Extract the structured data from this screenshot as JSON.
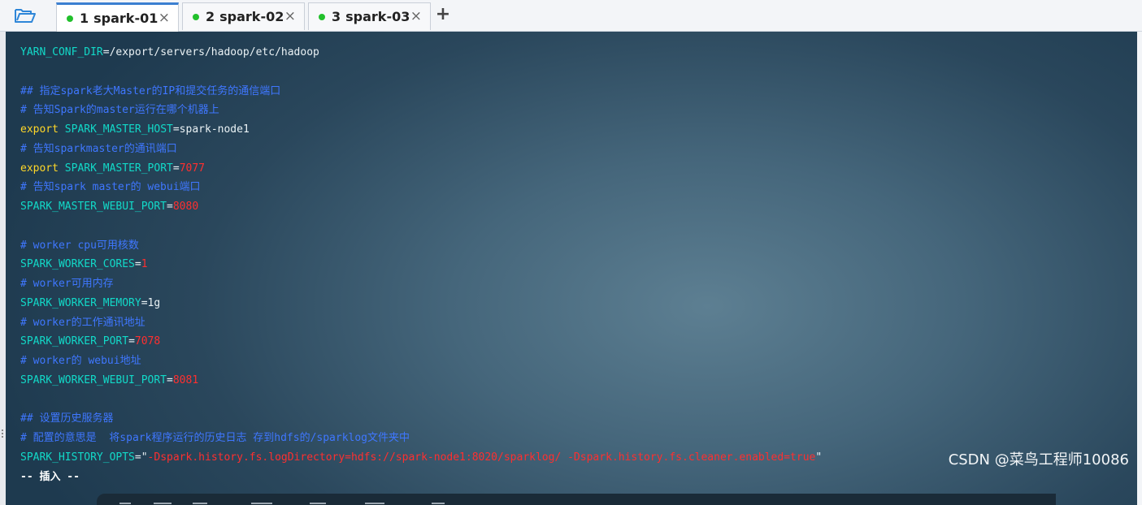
{
  "colors": {
    "accent": "#3b7fd1",
    "session_dot": "#22c02c",
    "variable": "#12d9c8",
    "value_number": "#ff2f2f",
    "keyword": "#ffd728",
    "comment": "#3f77ff"
  },
  "toolbar": {
    "folder_icon": "folder-open-icon"
  },
  "tabs": [
    {
      "number": "1",
      "label": "spark-01",
      "close": "×",
      "active": true
    },
    {
      "number": "2",
      "label": "spark-02",
      "close": "×",
      "active": false
    },
    {
      "number": "3",
      "label": "spark-03",
      "close": "×",
      "active": false
    }
  ],
  "add_tab": "+",
  "terminal": {
    "lines": [
      [
        {
          "text": "YARN_CONF_DIR",
          "cls": "var"
        },
        {
          "text": "=/export/servers/hadoop/etc/hadoop",
          "cls": "plain"
        }
      ],
      [],
      [
        {
          "text": "## 指定spark老大Master的IP和提交任务的通信端口",
          "cls": "comment"
        }
      ],
      [
        {
          "text": "# 告知Spark的master运行在哪个机器上",
          "cls": "comment"
        }
      ],
      [
        {
          "text": "export ",
          "cls": "yellow"
        },
        {
          "text": "SPARK_MASTER_HOST",
          "cls": "var"
        },
        {
          "text": "=spark-node1",
          "cls": "plain"
        }
      ],
      [
        {
          "text": "# 告知sparkmaster的通讯端口",
          "cls": "comment"
        }
      ],
      [
        {
          "text": "export ",
          "cls": "yellow"
        },
        {
          "text": "SPARK_MASTER_PORT",
          "cls": "var"
        },
        {
          "text": "=",
          "cls": "plain"
        },
        {
          "text": "7077",
          "cls": "red"
        }
      ],
      [
        {
          "text": "# 告知spark master的 webui端口",
          "cls": "comment"
        }
      ],
      [
        {
          "text": "SPARK_MASTER_WEBUI_PORT",
          "cls": "var"
        },
        {
          "text": "=",
          "cls": "plain"
        },
        {
          "text": "8080",
          "cls": "red"
        }
      ],
      [],
      [
        {
          "text": "# worker cpu可用核数",
          "cls": "comment"
        }
      ],
      [
        {
          "text": "SPARK_WORKER_CORES",
          "cls": "var"
        },
        {
          "text": "=",
          "cls": "plain"
        },
        {
          "text": "1",
          "cls": "red"
        }
      ],
      [
        {
          "text": "# worker可用内存",
          "cls": "comment"
        }
      ],
      [
        {
          "text": "SPARK_WORKER_MEMORY",
          "cls": "var"
        },
        {
          "text": "=1g",
          "cls": "plain"
        }
      ],
      [
        {
          "text": "# worker的工作通讯地址",
          "cls": "comment"
        }
      ],
      [
        {
          "text": "SPARK_WORKER_PORT",
          "cls": "var"
        },
        {
          "text": "=",
          "cls": "plain"
        },
        {
          "text": "7078",
          "cls": "red"
        }
      ],
      [
        {
          "text": "# worker的 webui地址",
          "cls": "comment"
        }
      ],
      [
        {
          "text": "SPARK_WORKER_WEBUI_PORT",
          "cls": "var"
        },
        {
          "text": "=",
          "cls": "plain"
        },
        {
          "text": "8081",
          "cls": "red"
        }
      ],
      [],
      [
        {
          "text": "## 设置历史服务器",
          "cls": "comment"
        }
      ],
      [
        {
          "text": "# 配置的意思是  将spark程序运行的历史日志 存到hdfs的/sparklog文件夹中",
          "cls": "comment"
        }
      ],
      [
        {
          "text": "SPARK_HISTORY_OPTS",
          "cls": "var"
        },
        {
          "text": "=\"",
          "cls": "plain"
        },
        {
          "text": "-Dspark.history.fs.logDirectory=hdfs://spark-node1:8020/sparklog/ -Dspark.history.fs.cleaner.enabled=true",
          "cls": "red"
        },
        {
          "text": "\"",
          "cls": "plain"
        }
      ],
      [
        {
          "text": "-- 插入 --",
          "cls": "mode"
        }
      ]
    ]
  },
  "watermark": "CSDN @菜鸟工程师10086"
}
